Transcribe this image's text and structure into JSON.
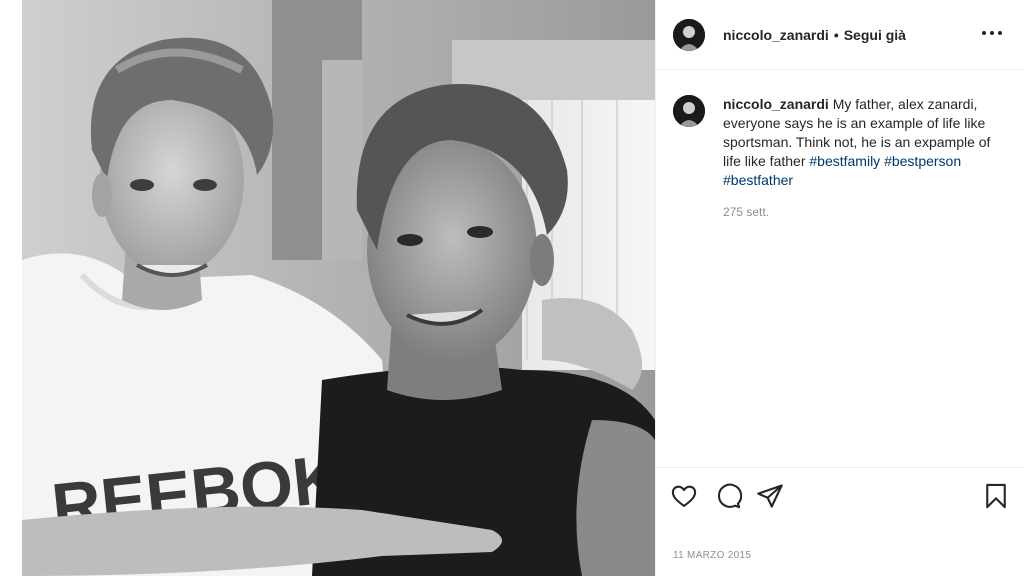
{
  "header": {
    "username": "niccolo_zanardi",
    "separator": "•",
    "follow_label": "Segui già"
  },
  "caption": {
    "username": "niccolo_zanardi",
    "text": "My father, alex zanardi, everyone says he is an example of life like sportsman. Think not, he is an expample of life like father",
    "hashtags": [
      "#bestfamily",
      "#bestperson",
      "#bestfather"
    ],
    "age": "275 sett."
  },
  "photo": {
    "shirt_text": "REEBOK"
  },
  "actions": {
    "icons": [
      "heart-icon",
      "comment-icon",
      "share-icon",
      "bookmark-icon"
    ]
  },
  "post_date": "11 MARZO 2015",
  "colors": {
    "text": "#262626",
    "secondary": "#8e8e8e",
    "hashtag": "#00376b",
    "border": "#efefef"
  }
}
